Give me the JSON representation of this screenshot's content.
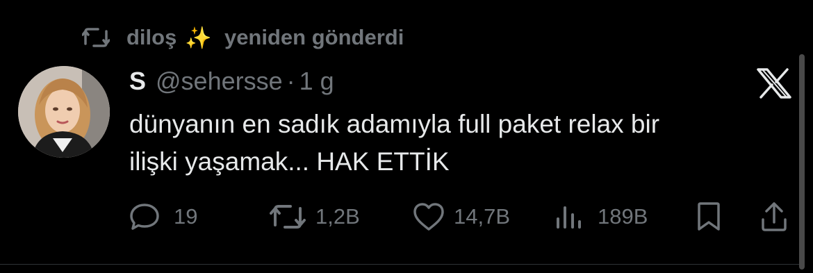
{
  "retweet": {
    "user": "diloş",
    "emoji": "✨",
    "action": "yeniden gönderdi"
  },
  "tweet": {
    "display_name": "S",
    "handle": "@sehersse",
    "separator": "·",
    "time": "1 g",
    "text": "dünyanın en sadık adamıyla full paket relax bir\nilişki yaşamak... HAK ETTİK"
  },
  "stats": {
    "replies": "19",
    "reposts": "1,2B",
    "likes": "14,7B",
    "views": "189B"
  },
  "icons": {
    "repost": "repost-icon",
    "reply": "reply-icon",
    "like": "heart-icon",
    "views": "views-icon",
    "bookmark": "bookmark-icon",
    "share": "share-icon",
    "platform": "x-logo-icon"
  },
  "colors": {
    "background": "#000000",
    "text": "#e7e9ea",
    "secondary": "#71767b"
  }
}
